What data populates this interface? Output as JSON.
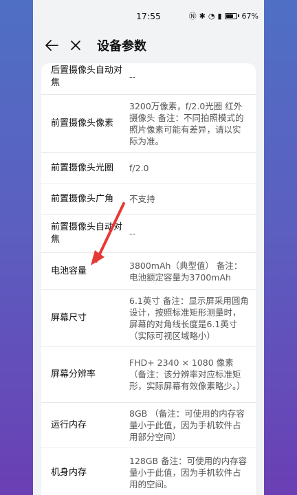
{
  "status": {
    "time": "17:55",
    "battery": "67%"
  },
  "header": {
    "title": "设备参数"
  },
  "params": [
    {
      "key": "后置摄像头自动对焦",
      "value": "--"
    },
    {
      "key": "前置摄像头像素",
      "value": "3200万像素，f/2.0光圈 红外摄像头 备注：不同拍照模式的照片像素可能有差异，请以实际为准。"
    },
    {
      "key": "前置摄像头光圈",
      "value": "f/2.0"
    },
    {
      "key": "前置摄像头广角",
      "value": "不支持"
    },
    {
      "key": "前置摄像头自动对焦",
      "value": "--"
    },
    {
      "key": "电池容量",
      "value": "3800mAh（典型值） 备注：电池额定容量为3700mAh"
    },
    {
      "key": "屏幕尺寸",
      "value": "6.1英寸 备注：显示屏采用圆角设计，按照标准矩形测量时，屏幕的对角线长度是6.1英寸（实际可视区域略小）"
    },
    {
      "key": "屏幕分辨率",
      "value": "FHD+ 2340 × 1080 像素（备注：该分辨率对应标准矩形，实际屏幕有效像素略少。）"
    },
    {
      "key": "运行内存",
      "value": "8GB （备注：可使用的内存容量小于此值，因为手机软件占用部分空间）"
    },
    {
      "key": "机身内存",
      "value": "128GB 备注：可使用的内存容量小于此值，因为手机软件占用的空间。"
    }
  ],
  "colors": {
    "annotation_arrow": "#e53935"
  }
}
